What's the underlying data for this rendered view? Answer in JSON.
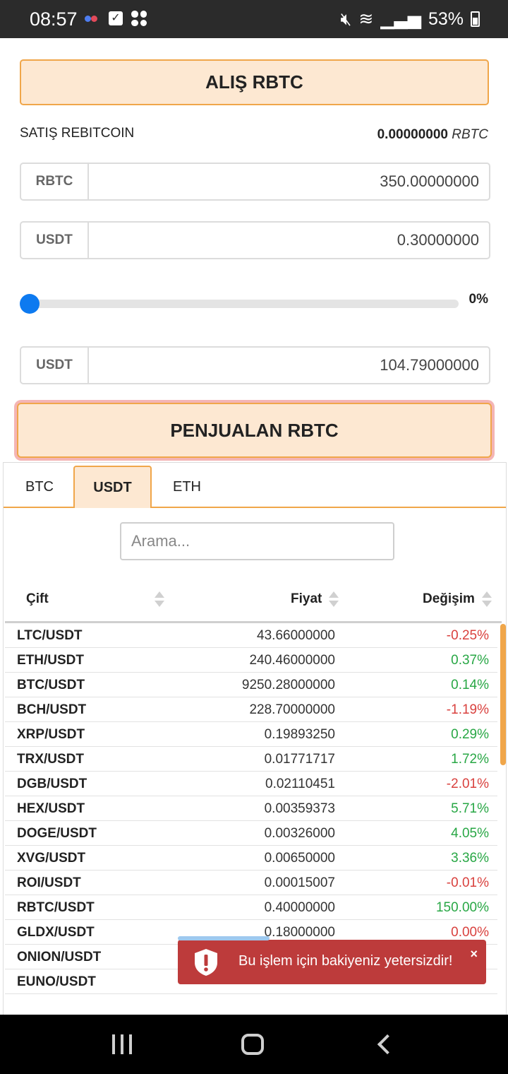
{
  "status_bar": {
    "time": "08:57",
    "battery": "53%"
  },
  "buy_header": {
    "label": "ALIŞ RBTC"
  },
  "sell": {
    "label": "SATIŞ REBITCOIN",
    "balance_amount": "0.00000000",
    "balance_unit": "RBTC"
  },
  "inputs": [
    {
      "currency": "RBTC",
      "value": "350.00000000"
    },
    {
      "currency": "USDT",
      "value": "0.30000000"
    },
    {
      "currency": "USDT",
      "value": "104.79000000"
    }
  ],
  "slider": {
    "percent_label": "0%",
    "level_fraction": 0
  },
  "sell_button": {
    "label": "PENJUALAN RBTC"
  },
  "tabs": [
    "BTC",
    "USDT",
    "ETH"
  ],
  "active_tab": "USDT",
  "search": {
    "placeholder": "Arama..."
  },
  "table": {
    "headers": {
      "pair": "Çift",
      "price": "Fiyat",
      "change": "Değişim"
    },
    "rows": [
      {
        "pair": "LTC/USDT",
        "price": "43.66000000",
        "change": "-0.25%",
        "trend": "neg"
      },
      {
        "pair": "ETH/USDT",
        "price": "240.46000000",
        "change": "0.37%",
        "trend": "pos"
      },
      {
        "pair": "BTC/USDT",
        "price": "9250.28000000",
        "change": "0.14%",
        "trend": "pos"
      },
      {
        "pair": "BCH/USDT",
        "price": "228.70000000",
        "change": "-1.19%",
        "trend": "neg"
      },
      {
        "pair": "XRP/USDT",
        "price": "0.19893250",
        "change": "0.29%",
        "trend": "pos"
      },
      {
        "pair": "TRX/USDT",
        "price": "0.01771717",
        "change": "1.72%",
        "trend": "pos"
      },
      {
        "pair": "DGB/USDT",
        "price": "0.02110451",
        "change": "-2.01%",
        "trend": "neg"
      },
      {
        "pair": "HEX/USDT",
        "price": "0.00359373",
        "change": "5.71%",
        "trend": "pos"
      },
      {
        "pair": "DOGE/USDT",
        "price": "0.00326000",
        "change": "4.05%",
        "trend": "pos"
      },
      {
        "pair": "XVG/USDT",
        "price": "0.00650000",
        "change": "3.36%",
        "trend": "pos"
      },
      {
        "pair": "ROI/USDT",
        "price": "0.00015007",
        "change": "-0.01%",
        "trend": "neg"
      },
      {
        "pair": "RBTC/USDT",
        "price": "0.40000000",
        "change": "150.00%",
        "trend": "pos"
      },
      {
        "pair": "GLDX/USDT",
        "price": "0.18000000",
        "change": "0.00%",
        "trend": "neg"
      },
      {
        "pair": "ONION/USDT",
        "price": "",
        "change": "",
        "trend": "neg"
      },
      {
        "pair": "EUNO/USDT",
        "price": "",
        "change": "",
        "trend": "neg"
      }
    ]
  },
  "toast": {
    "message": "Bu işlem için bakiyeniz yetersizdir!",
    "close": "×"
  },
  "colors": {
    "accent": "#f0a64a",
    "accent_bg": "#fde8d2",
    "slider": "#0d7af0",
    "negative": "#d9413e",
    "positive": "#28a745",
    "toast": "#bd3b3b"
  }
}
